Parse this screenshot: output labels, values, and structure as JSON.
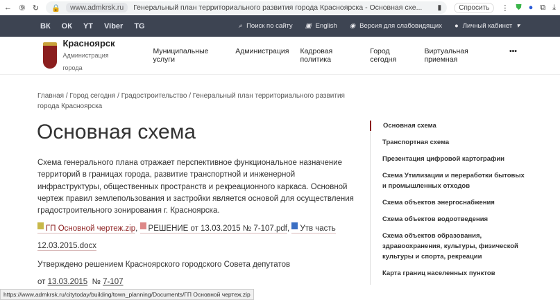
{
  "browser": {
    "domain": "www.admkrsk.ru",
    "title": "Генеральный план территориального развития города Красноярска - Основная схе...",
    "ask": "Спросить",
    "status_url": "https://www.admkrsk.ru/citytoday/building/town_planning/Documents/ГП Основной чертеж.zip"
  },
  "topbar": {
    "social": [
      "ВК",
      "ОК",
      "YT",
      "Viber",
      "TG"
    ],
    "search": "Поиск по сайту",
    "lang": "English",
    "accessible": "Версия для слабовидящих",
    "account": "Личный кабинет"
  },
  "brand": {
    "name": "Красноярск",
    "sub": "Администрация города"
  },
  "menu": [
    "Муниципальные услуги",
    "Администрация",
    "Кадровая политика",
    "Город сегодня",
    "Виртуальная приемная",
    "•••"
  ],
  "breadcrumbs": [
    "Главная",
    "Город сегодня",
    "Градостроительство",
    "Генеральный план территориального развития города Красноярска"
  ],
  "title": "Основная схема",
  "paragraph": "Схема генерального плана отражает перспективное функциональное назначение территорий в границах города, развитие транспортной и инженерной инфраструктуры, общественных пространств и рекреационного каркаса.  Основной чертеж правил землепользования и застройки является основой для осуществления градостроительного зонирования г. Красноярска.",
  "files": [
    "ГП Основной чертеж.zip",
    "РЕШЕНИЕ от 13.03.2015 № 7-107.pdf",
    "Утв часть 12.03.2015.docx"
  ],
  "approved": {
    "text": "Утверждено решением Красноярского городского Совета депутатов",
    "from": "от",
    "date": "13.03.2015",
    "no": "№",
    "number": "7-107"
  },
  "sidebar": [
    "Основная схема",
    "Транспортная схема",
    "Презентация цифровой картографии",
    "Схема Утилизации и переработки бытовых и промышленных отходов",
    "Схема объектов энергоснабжения",
    "Схема объектов водоотведения",
    "Схема объектов образования, здравоохранения, культуры, физической культуры и спорта, рекреации",
    "Карта границ населенных пунктов"
  ]
}
